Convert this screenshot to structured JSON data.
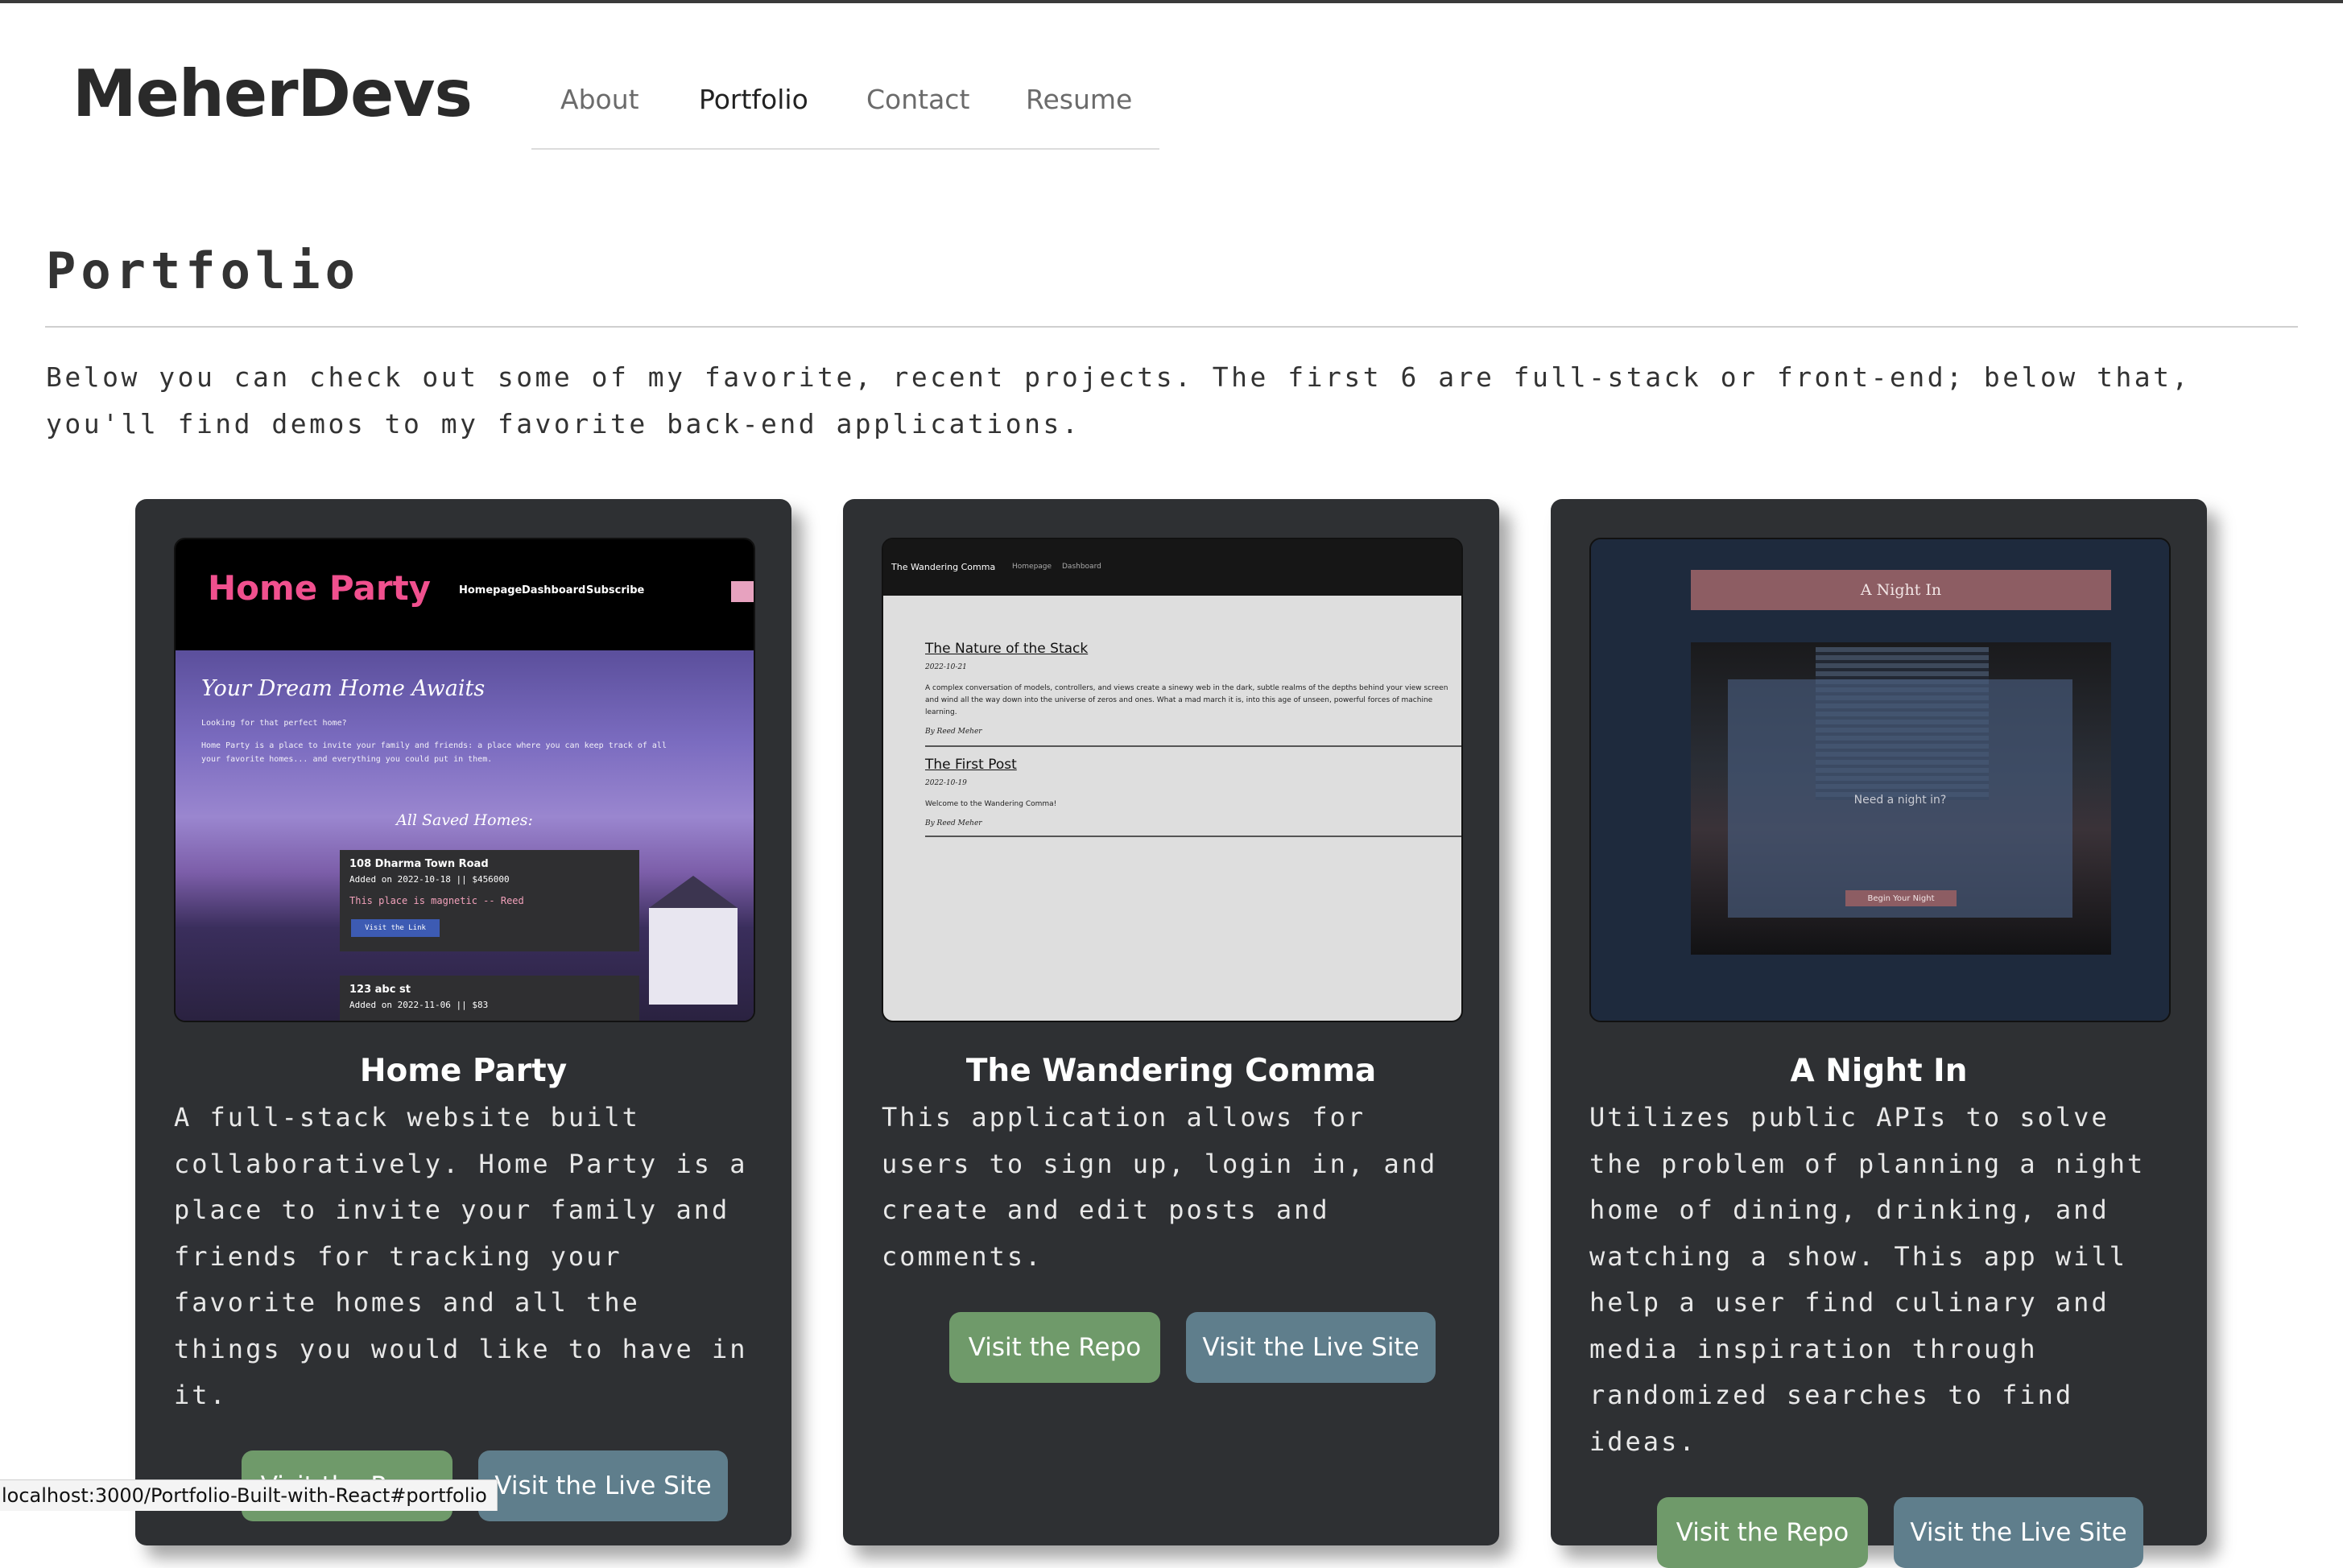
{
  "brand": "MeherDevs",
  "nav": {
    "items": [
      {
        "label": "About",
        "active": false
      },
      {
        "label": "Portfolio",
        "active": true
      },
      {
        "label": "Contact",
        "active": false
      },
      {
        "label": "Resume",
        "active": false
      }
    ]
  },
  "page": {
    "title": "Portfolio",
    "intro": "Below you can check out some of my favorite, recent projects. The first 6 are full-stack or front-end; below that, you'll find demos to my favorite back-end applications."
  },
  "projects": [
    {
      "title": "Home Party",
      "description": "A full-stack website built collaboratively. Home Party is a place to invite your family and friends for tracking your favorite homes and all the things you would like to have in it.",
      "repo_label": "Visit the Repo",
      "live_label": "Visit the Live Site",
      "screenshot": {
        "logo": "Home Party",
        "nav": [
          "Homepage",
          "Dashboard",
          "Subscribe"
        ],
        "headline": "Your Dream Home Awaits",
        "sub": "Looking for that perfect home?",
        "blurb1": "Home Party is a place to invite your family and friends: a place where you can keep track of all",
        "blurb2": "your favorite homes... and everything you could put in them.",
        "saved_heading": "All Saved Homes:",
        "home1": {
          "name": "108 Dharma Town Road",
          "meta": "Added on 2022-10-18 || $456000",
          "quote": "This place is magnetic -- Reed",
          "link": "Visit the Link"
        },
        "home2": {
          "name": "123 abc st",
          "meta": "Added on 2022-11-06 || $83"
        }
      }
    },
    {
      "title": "The Wandering Comma",
      "description": "This application allows for users to sign up, login in, and create and edit posts and comments.",
      "repo_label": "Visit the Repo",
      "live_label": "Visit the Live Site",
      "screenshot": {
        "site_title": "The Wandering Comma",
        "nav": [
          "Homepage",
          "Dashboard"
        ],
        "post1": {
          "title": "The Nature of the Stack",
          "date": "2022-10-21",
          "text": "A complex conversation of models, controllers, and views create a sinewy web in the dark, subtle realms of the depths behind your view screen and wind all the way down into the universe of zeros and ones. What a mad march it is, into this age of unseen, powerful forces of machine learning.",
          "by": "By Reed Meher"
        },
        "post2": {
          "title": "The First Post",
          "date": "2022-10-19",
          "text": "Welcome to the Wandering Comma!",
          "by": "By Reed Meher"
        }
      }
    },
    {
      "title": "A Night In",
      "description": "Utilizes public APIs to solve the problem of planning a night home of dining, drinking, and watching a show. This app will help a user find culinary and media inspiration through randomized searches to find ideas.",
      "repo_label": "Visit the Repo",
      "live_label": "Visit the Live Site",
      "screenshot": {
        "banner": "A Night In",
        "question": "Need a night in?",
        "button": "Begin Your Night"
      }
    }
  ],
  "status_url": "localhost:3000/Portfolio-Built-with-React#portfolio",
  "colors": {
    "card_bg": "#2e3033",
    "repo_button": "#6f9a6a",
    "live_button": "#5f7e8c",
    "home_party_pink": "#f0508e"
  }
}
